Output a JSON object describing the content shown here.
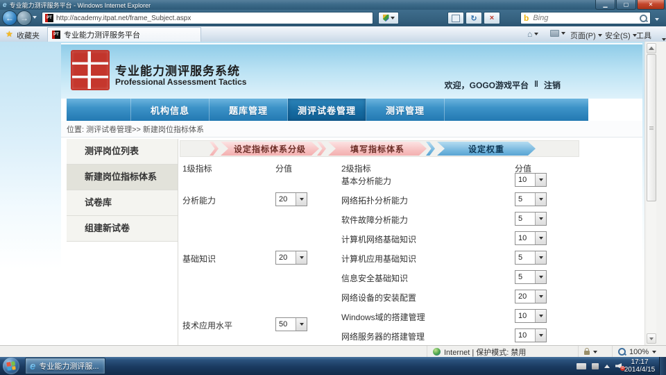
{
  "window": {
    "title": "专业能力测评服务平台 - Windows Internet Explorer",
    "url": "http://academy.itpat.net/frame_Subject.aspx",
    "search_placeholder": "Bing",
    "favorites_label": "收藏夹",
    "tab_title": "专业能力测评服务平台",
    "menu_page": "页面(P)",
    "menu_safety": "安全(S)",
    "menu_tools": "工具(O)",
    "status_zone": "Internet | 保护模式: 禁用",
    "status_zoom": "100%"
  },
  "header": {
    "system_title": "专业能力测评服务系统",
    "system_subtitle": "Professional Assessment Tactics",
    "welcome": "欢迎，GOGO游戏平台",
    "separator": "‖",
    "logout": "注销"
  },
  "nav": {
    "items": [
      {
        "label": "机构信息"
      },
      {
        "label": "题库管理"
      },
      {
        "label": "测评试卷管理"
      },
      {
        "label": "测评管理"
      }
    ]
  },
  "breadcrumb": "位置: 测评试卷管理>> 新建岗位指标体系",
  "sidebar": {
    "items": [
      {
        "label": "测评岗位列表"
      },
      {
        "label": "新建岗位指标体系"
      },
      {
        "label": "试卷库"
      },
      {
        "label": "组建新试卷"
      }
    ]
  },
  "steps": [
    {
      "label": "设定指标体系分级"
    },
    {
      "label": "填写指标体系"
    },
    {
      "label": "设定权重"
    }
  ],
  "table": {
    "header_l1": "1级指标",
    "header_v1": "分值",
    "header_l2": "2级指标",
    "header_v2": "分值",
    "rows": [
      {
        "l2": "基本分析能力",
        "v2": "10"
      },
      {
        "l1": "分析能力",
        "v1": "20",
        "l2": "网络拓扑分析能力",
        "v2": "5"
      },
      {
        "l2": "软件故障分析能力",
        "v2": "5"
      },
      {
        "l2": "计算机网络基础知识",
        "v2": "10"
      },
      {
        "l1": "基础知识",
        "v1": "20",
        "l2": "计算机应用基础知识",
        "v2": "5"
      },
      {
        "l2": "信息安全基础知识",
        "v2": "5"
      },
      {
        "l2": "网络设备的安装配置",
        "v2": "20"
      },
      {
        "l1": "技术应用水平",
        "v1": "50",
        "l2": "Windows域的搭建管理",
        "v2": "10"
      },
      {
        "l2": "网络服务器的搭建管理",
        "v2": "10"
      }
    ]
  },
  "taskbar": {
    "ie_button_label": "专业能力测评服...",
    "time": "17:17",
    "date": "2014/4/15"
  },
  "colors": {
    "nav_blue": "#2379b2",
    "step_pink": "#f6bcbc",
    "step_blue": "#6fb3dc",
    "seal_red": "#c5281c"
  }
}
